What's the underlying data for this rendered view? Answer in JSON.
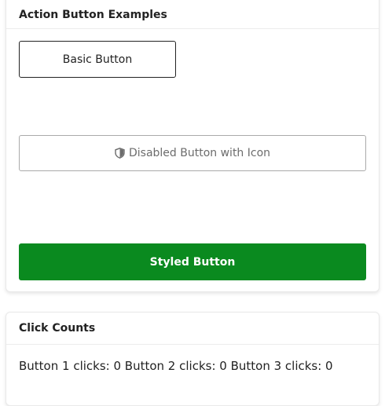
{
  "action_card": {
    "title": "Action Button Examples",
    "basic_button_label": "Basic Button",
    "disabled_button_label": "Disabled Button with Icon",
    "disabled_button_icon": "shield-icon",
    "styled_button_label": "Styled Button",
    "styled_button_color": "#0a8a1f"
  },
  "counts_card": {
    "title": "Click Counts",
    "counts_text": "Button 1 clicks: 0 Button 2 clicks: 0 Button 3 clicks: 0"
  }
}
